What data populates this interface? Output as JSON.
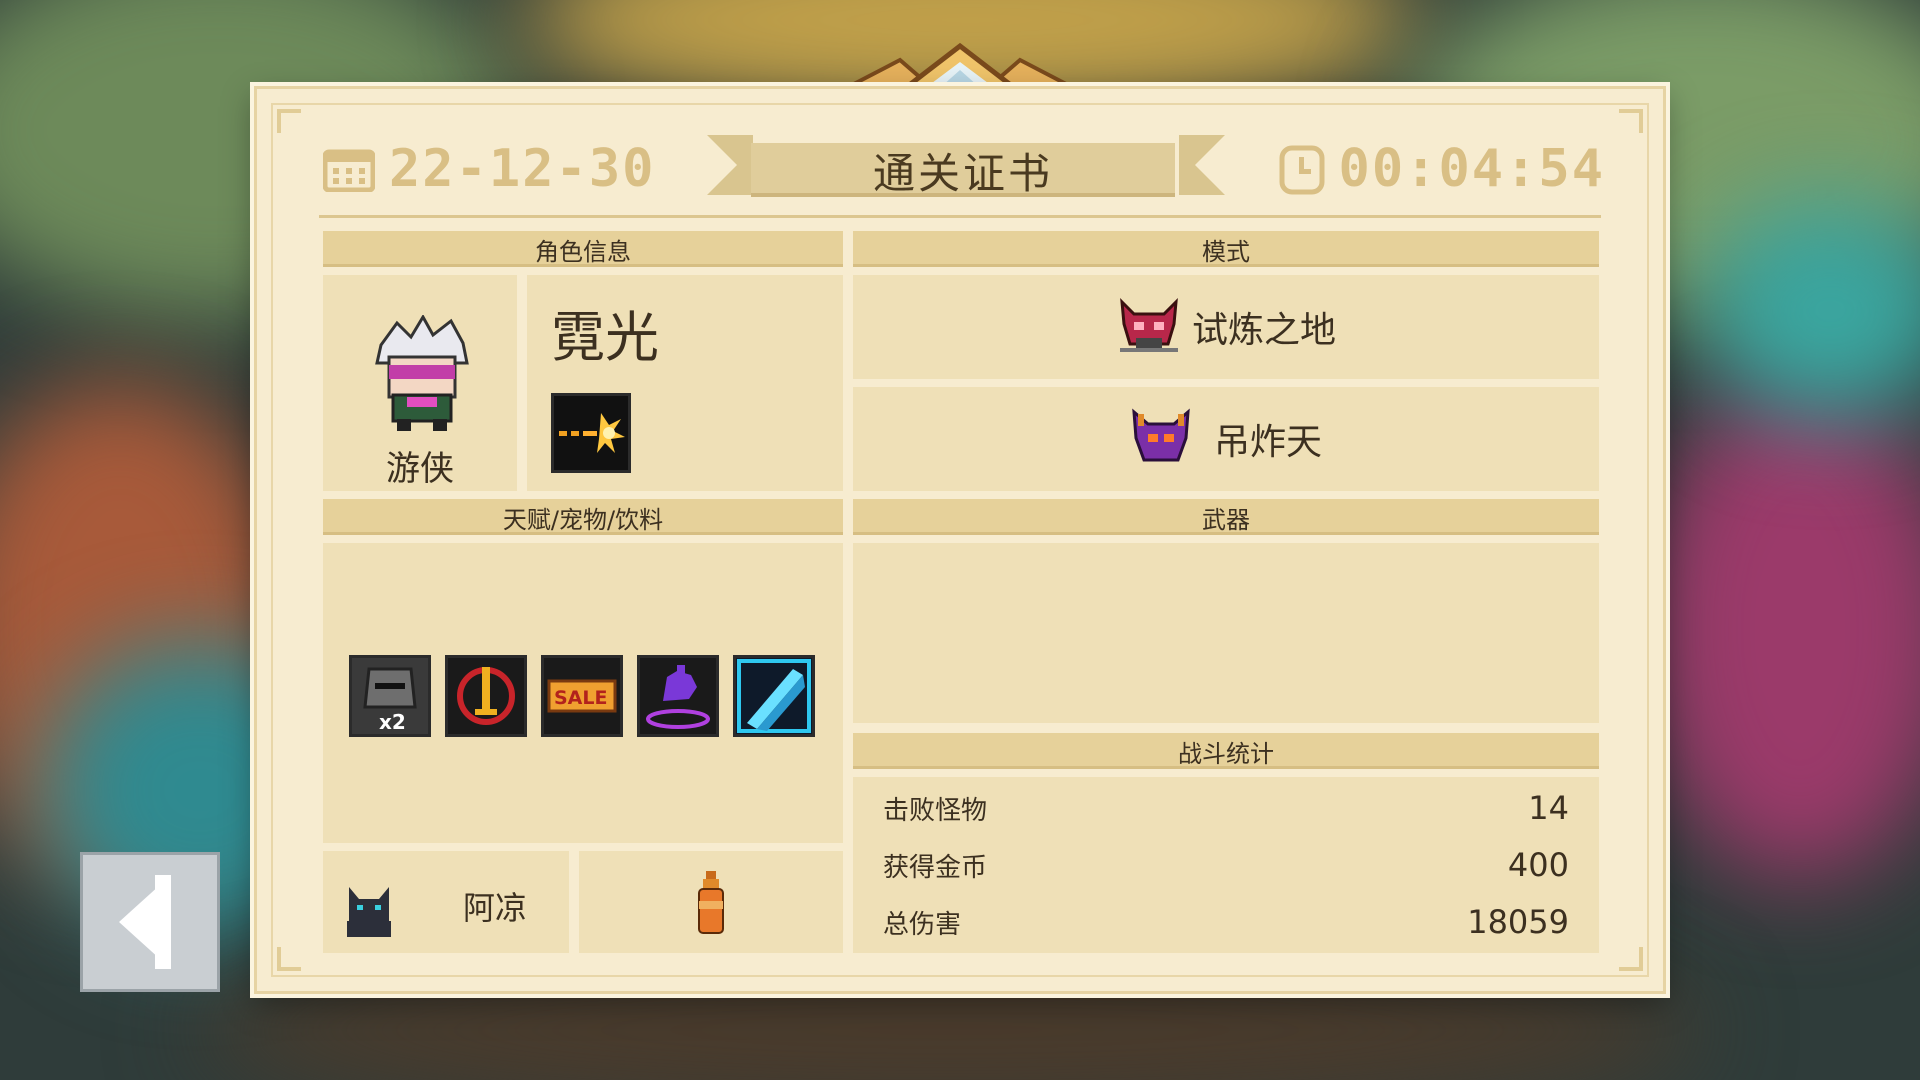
{
  "header": {
    "date": "22-12-30",
    "timer": "00:04:54",
    "title": "通关证书"
  },
  "character": {
    "header": "角色信息",
    "name": "霓光",
    "class": "游侠"
  },
  "mode": {
    "header": "模式",
    "items": [
      {
        "label": "试炼之地",
        "icon": "demon-mask-icon"
      },
      {
        "label": "吊炸天",
        "icon": "purple-demon-icon"
      }
    ]
  },
  "talents": {
    "header": "天赋/宠物/饮料",
    "icons": [
      "knight-x2-icon",
      "sword-shield-icon",
      "sale-icon",
      "purple-hand-icon",
      "cyan-slash-icon"
    ],
    "pet_name": "阿凉",
    "pet_icon": "black-cat-icon",
    "drink_icon": "orange-bottle-icon"
  },
  "weapons": {
    "header": "武器"
  },
  "stats": {
    "header": "战斗统计",
    "rows": [
      {
        "label": "击败怪物",
        "value": "14"
      },
      {
        "label": "获得金币",
        "value": "400"
      },
      {
        "label": "总伤害",
        "value": "18059"
      }
    ]
  },
  "nav": {
    "back_icon": "back-arrow-icon"
  }
}
